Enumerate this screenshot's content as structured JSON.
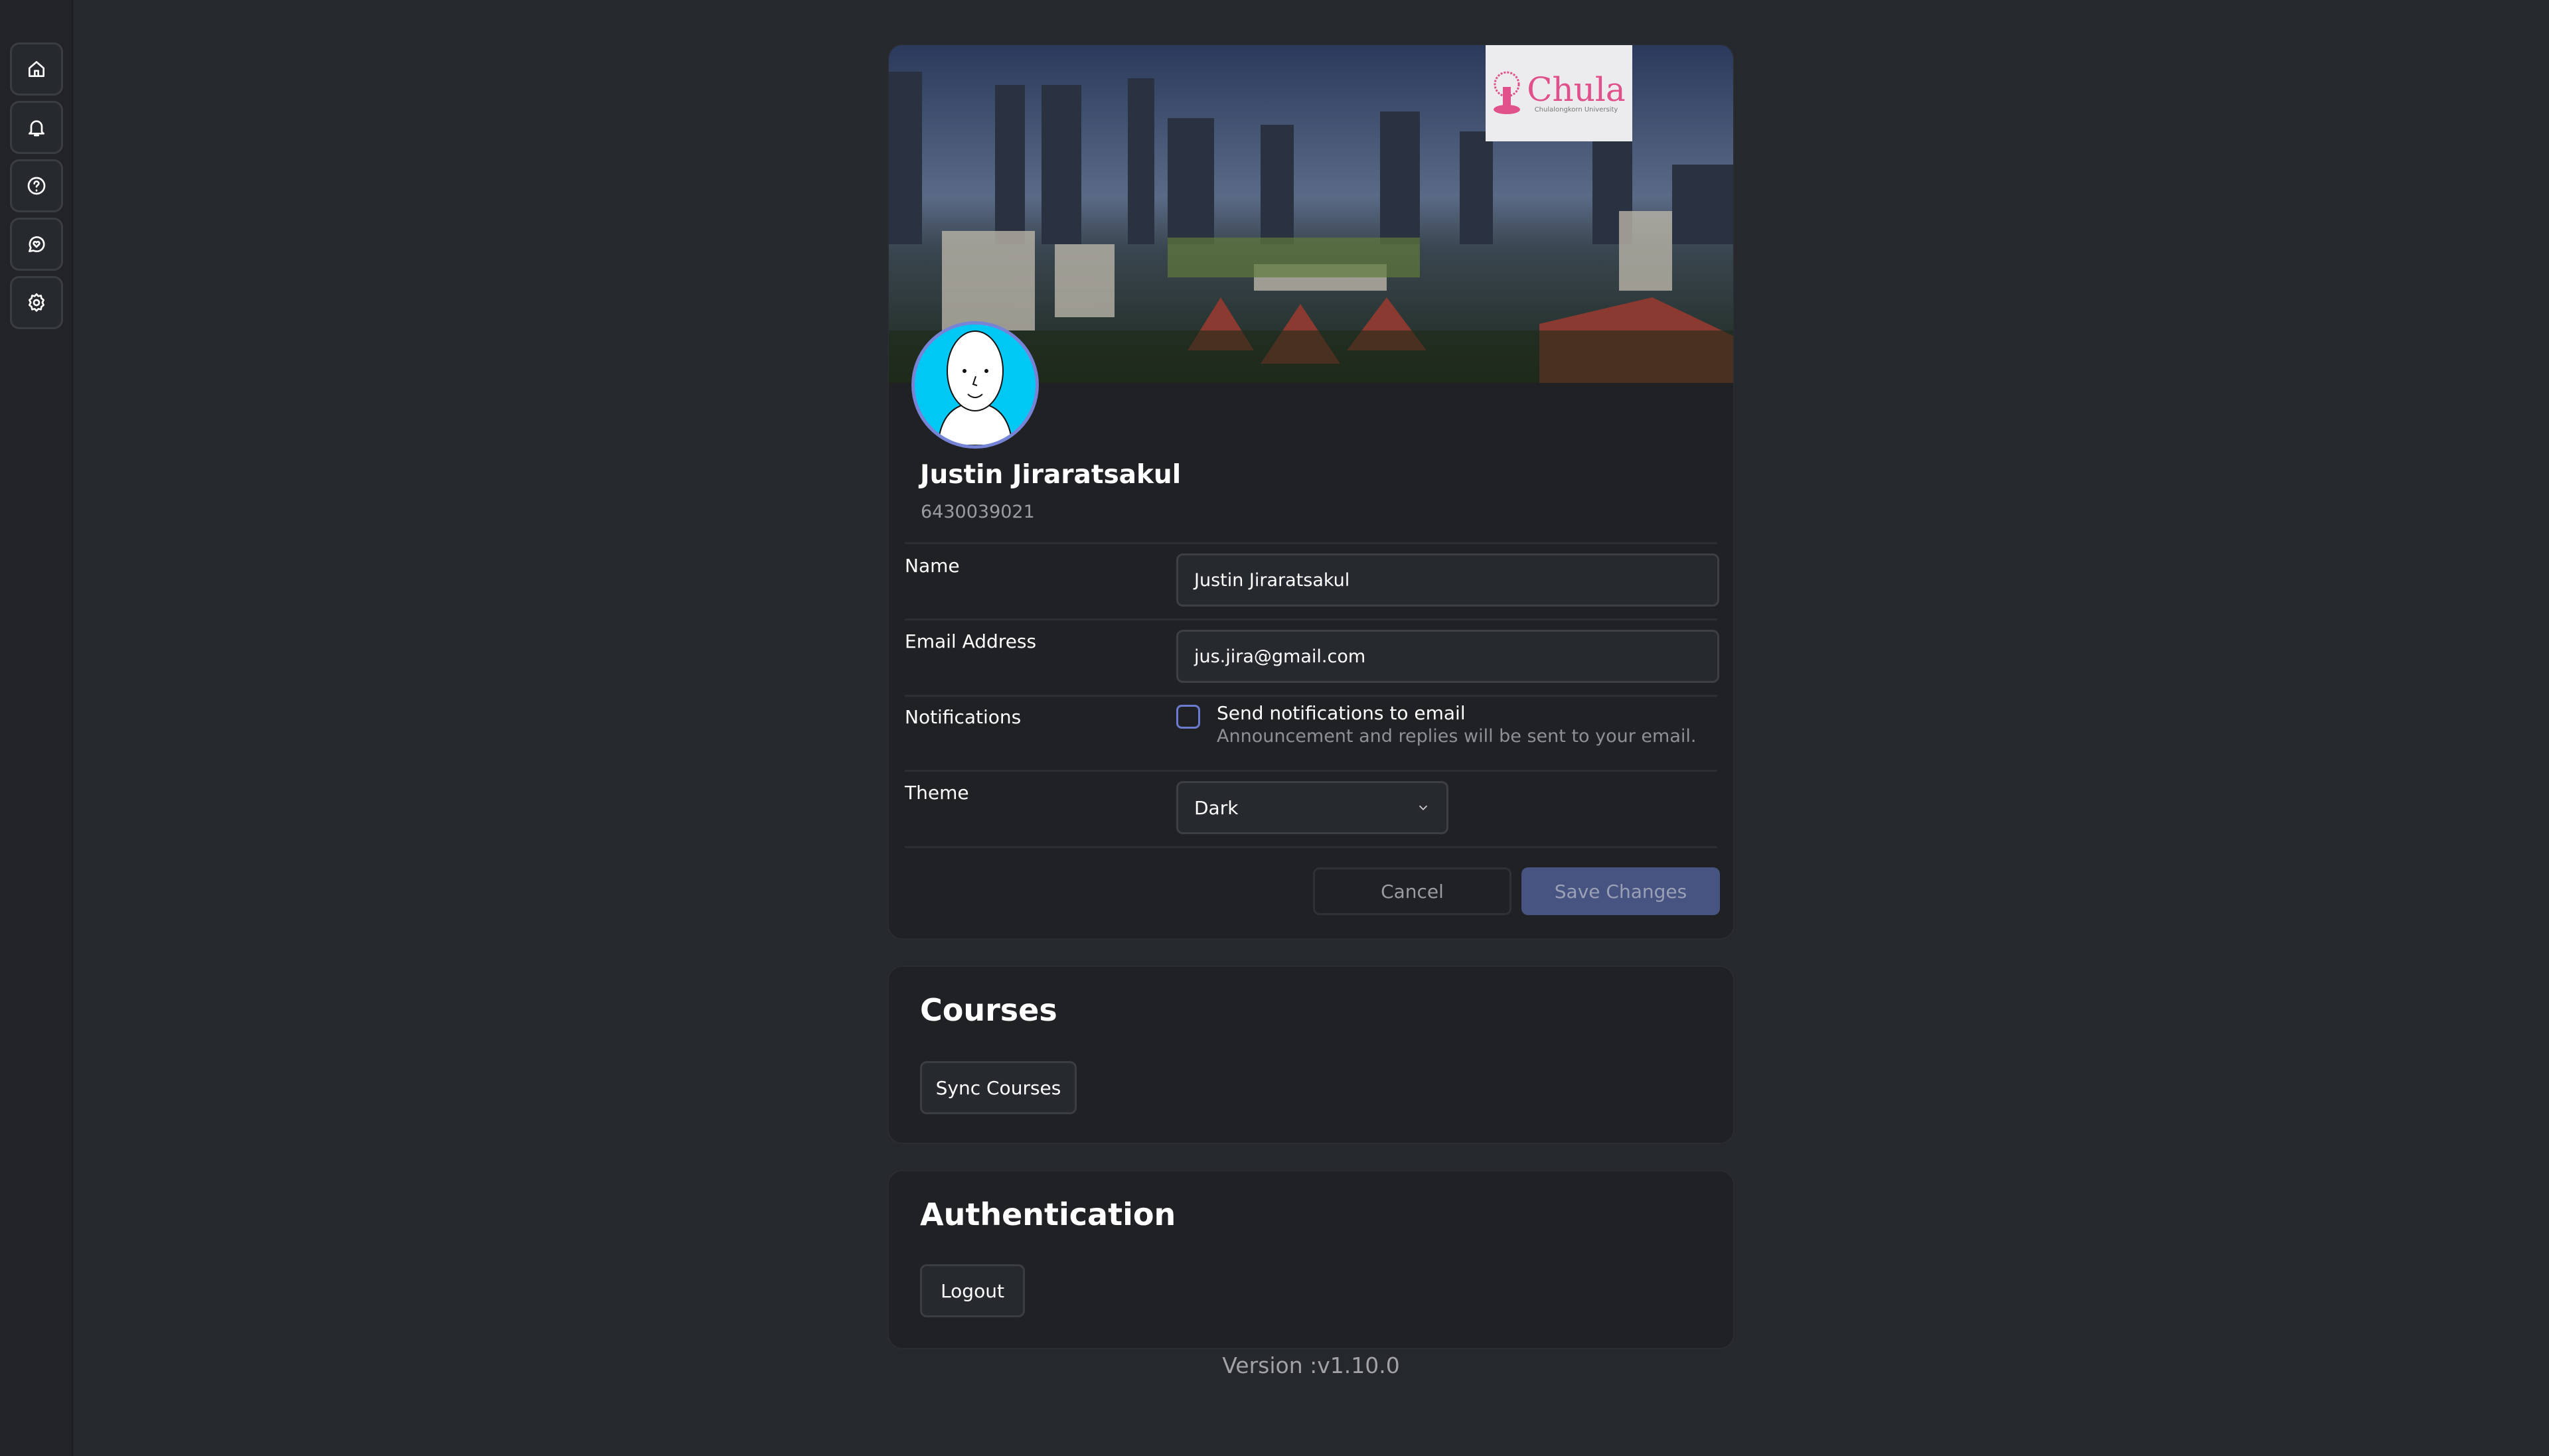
{
  "sidebar": {
    "items": [
      {
        "name": "home",
        "icon": "home-icon"
      },
      {
        "name": "notifications",
        "icon": "bell-icon"
      },
      {
        "name": "help",
        "icon": "question-circle-icon"
      },
      {
        "name": "feedback",
        "icon": "chat-heart-icon"
      },
      {
        "name": "settings",
        "icon": "gear-icon"
      }
    ]
  },
  "profile": {
    "logo_text": "Chula",
    "logo_subtext": "Chulalongkorn University",
    "name": "Justin Jiraratsakul",
    "student_id": "6430039021"
  },
  "form": {
    "name_label": "Name",
    "name_value": "Justin Jiraratsakul",
    "email_label": "Email Address",
    "email_value": "jus.jira@gmail.com",
    "notifications_label": "Notifications",
    "notifications_checkbox_label": "Send notifications to email",
    "notifications_checked": false,
    "notifications_description": "Announcement and replies will be sent to your email.",
    "theme_label": "Theme",
    "theme_value": "Dark",
    "cancel_label": "Cancel",
    "save_label": "Save Changes"
  },
  "courses": {
    "title": "Courses",
    "sync_label": "Sync Courses"
  },
  "auth": {
    "title": "Authentication",
    "logout_label": "Logout"
  },
  "footer": {
    "version": "Version :v1.10.0"
  },
  "colors": {
    "accent": "#475381",
    "checkbox_border": "#6a7bd0",
    "logo_pink": "#e0508a"
  }
}
